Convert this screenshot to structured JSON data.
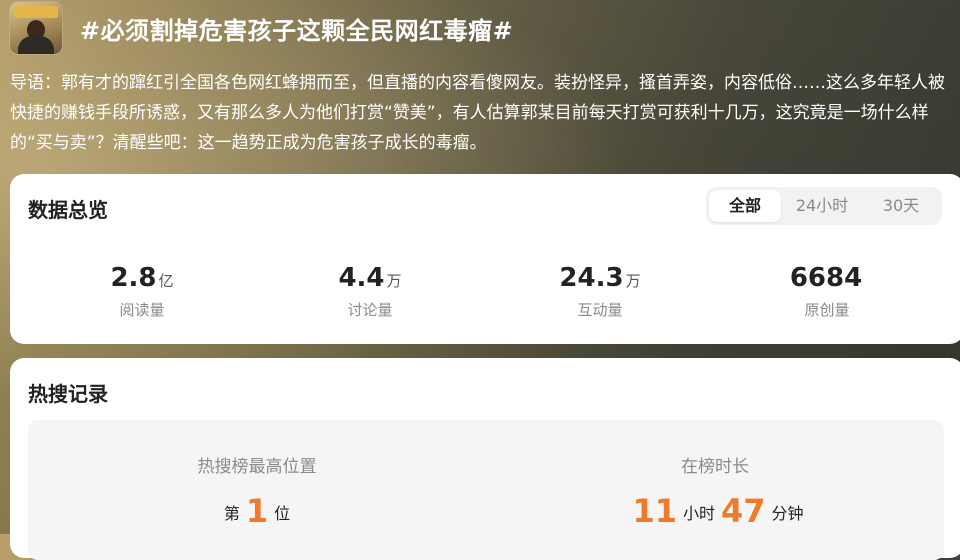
{
  "header": {
    "title": "#必须割掉危害孩子这颗全民网红毒瘤#",
    "avatar": "topic-avatar-photo"
  },
  "intro": "导语：郭有才的蹿红引全国各色网红蜂拥而至，但直播的内容看傻网友。装扮怪异，搔首弄姿，内容低俗……这么多年轻人被快捷的赚钱手段所诱惑，又有那么多人为他们打赏“赞美”，有人估算郭某目前每天打赏可获利十几万，这究竟是一场什么样的“买与卖”？清醒些吧：这一趋势正成为危害孩子成长的毒瘤。",
  "overview": {
    "title": "数据总览",
    "tabs": [
      {
        "label": "全部",
        "active": true
      },
      {
        "label": "24小时",
        "active": false
      },
      {
        "label": "30天",
        "active": false
      }
    ],
    "stats": [
      {
        "value": "2.8",
        "unit": "亿",
        "label": "阅读量"
      },
      {
        "value": "4.4",
        "unit": "万",
        "label": "讨论量"
      },
      {
        "value": "24.3",
        "unit": "万",
        "label": "互动量"
      },
      {
        "value": "6684",
        "unit": "",
        "label": "原创量"
      }
    ]
  },
  "hot": {
    "title": "热搜记录",
    "peak": {
      "label": "热搜榜最高位置",
      "prefix": "第",
      "number": "1",
      "suffix": "位"
    },
    "duration": {
      "label": "在榜时长",
      "hours": "11",
      "hours_unit": "小时",
      "minutes": "47",
      "minutes_unit": "分钟"
    }
  },
  "colors": {
    "accent_orange": "#ee7b2b",
    "card_bg": "#ffffff",
    "muted_text": "#8a8a8a"
  }
}
